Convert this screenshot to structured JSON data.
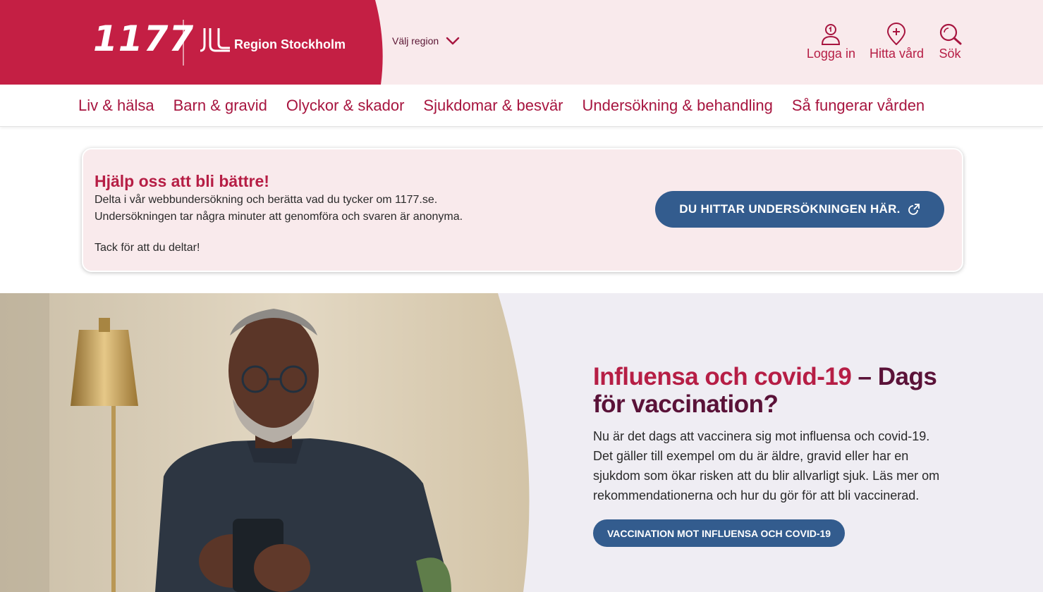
{
  "header": {
    "logo_text": "1177",
    "region_logo_text": "Region Stockholm",
    "region_select_label": "Välj region",
    "actions": [
      {
        "label": "Logga in",
        "icon": "user-icon"
      },
      {
        "label": "Hitta vård",
        "icon": "location-pin-icon"
      },
      {
        "label": "Sök",
        "icon": "search-icon"
      }
    ]
  },
  "nav": {
    "items": [
      "Liv & hälsa",
      "Barn & gravid",
      "Olyckor & skador",
      "Sjukdomar & besvär",
      "Undersökning & behandling",
      "Så fungerar vården"
    ]
  },
  "survey": {
    "title": "Hjälp oss att bli bättre!",
    "line1": "Delta i vår webbundersökning och berätta vad du tycker om 1177.se.",
    "line2": "Undersökningen tar några minuter att genomföra och svaren är anonyma.",
    "line3": "Tack för att du deltar!",
    "button_label": "DU HITTAR UNDERSÖKNINGEN HÄR.",
    "button_icon": "external-link-icon"
  },
  "hero": {
    "title_part1": "Influensa och covid-19",
    "title_part2": " – Dags för vaccination?",
    "body": "Nu är det dags att vaccinera sig mot influensa och covid-19. Det gäller till exempel om du är äldre, gravid eller har en sjukdom som ökar risken att du blir allvarligt sjuk. Läs mer om rekommendationerna och hur du gör för att bli vaccinerad.",
    "button_label": "VACCINATION MOT INFLUENSA OCH COVID-19"
  },
  "colors": {
    "brand_red": "#c41f44",
    "nav_text": "#a7153f",
    "header_bg": "#f9eaec",
    "button_blue": "#335c8e",
    "hero_bg": "#efedf3"
  }
}
